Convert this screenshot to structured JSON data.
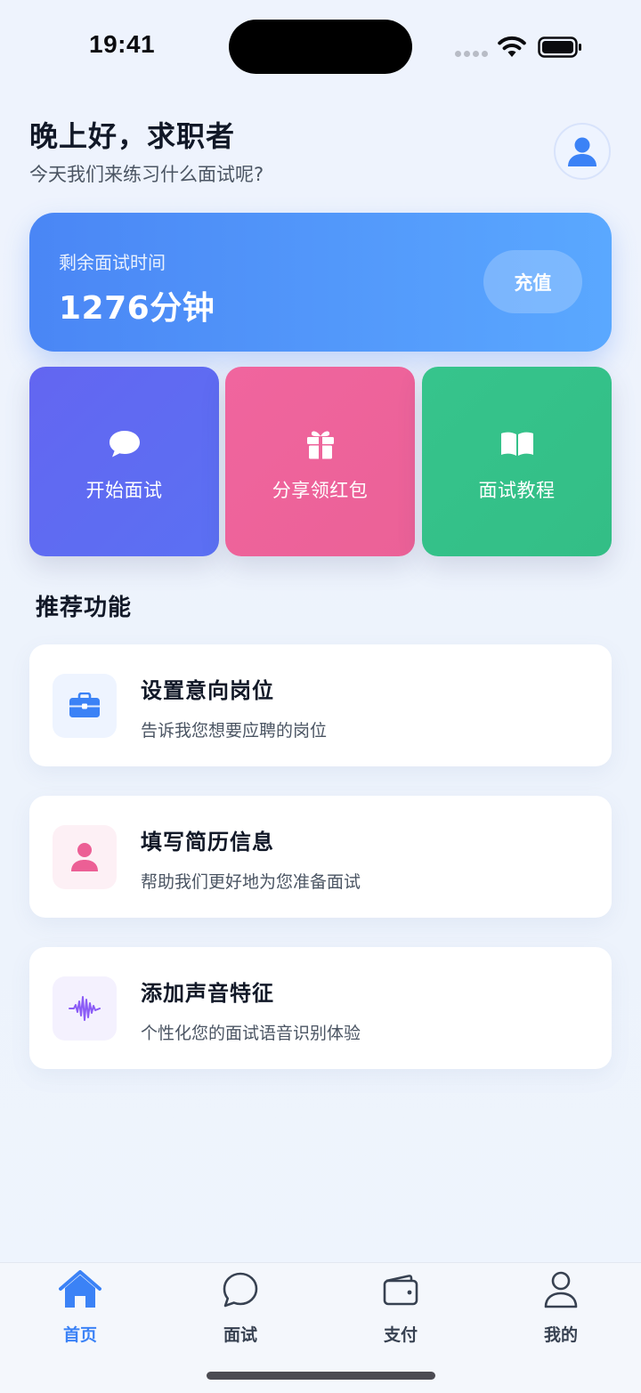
{
  "status_bar": {
    "time": "19:41"
  },
  "header": {
    "greeting": "晚上好，求职者",
    "subtitle": "今天我们来练习什么面试呢?",
    "avatar_icon": "user-icon"
  },
  "minutes_card": {
    "label": "剩余面试时间",
    "value": "1276分钟",
    "recharge_label": "充值"
  },
  "actions": [
    {
      "label": "开始面试",
      "icon": "chat-bubble-icon",
      "color": "#5b6cf2"
    },
    {
      "label": "分享领红包",
      "icon": "gift-icon",
      "color": "#ee649b"
    },
    {
      "label": "面试教程",
      "icon": "book-icon",
      "color": "#35c28a"
    }
  ],
  "recommended": {
    "title": "推荐功能",
    "items": [
      {
        "title": "设置意向岗位",
        "desc": "告诉我您想要应聘的岗位",
        "icon": "briefcase-icon",
        "color": "#3b82f6"
      },
      {
        "title": "填写简历信息",
        "desc": "帮助我们更好地为您准备面试",
        "icon": "person-icon",
        "color": "#ec5f95"
      },
      {
        "title": "添加声音特征",
        "desc": "个性化您的面试语音识别体验",
        "icon": "waveform-icon",
        "color": "#8b5cf6"
      }
    ]
  },
  "bottom_nav": [
    {
      "label": "首页",
      "icon": "home-icon",
      "active": true
    },
    {
      "label": "面试",
      "icon": "chat-icon",
      "active": false
    },
    {
      "label": "支付",
      "icon": "wallet-icon",
      "active": false
    },
    {
      "label": "我的",
      "icon": "profile-icon",
      "active": false
    }
  ],
  "colors": {
    "accent": "#3b82f6",
    "background": "#eef3fd"
  }
}
